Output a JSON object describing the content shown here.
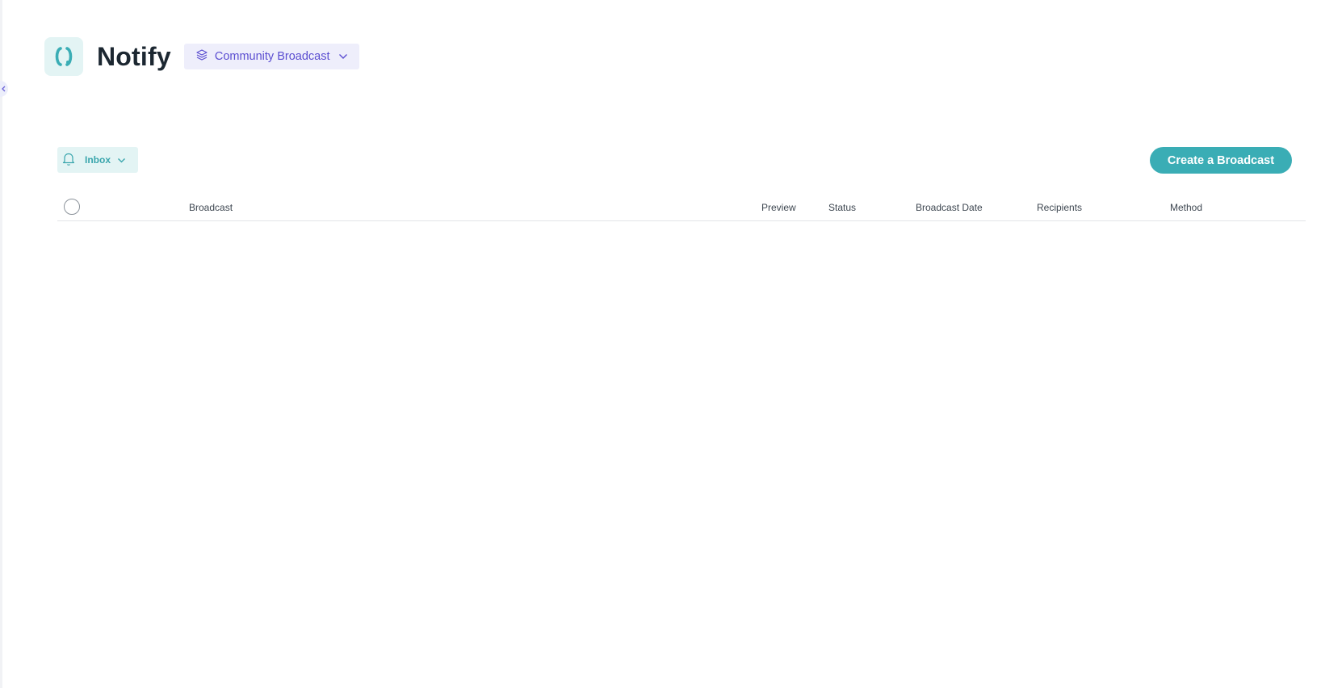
{
  "header": {
    "title": "Notify",
    "logo_icon": "notify-logo-icon",
    "scope_dropdown": {
      "selected": "Community Broadcast",
      "icon": "layers-icon"
    }
  },
  "toolbar": {
    "folder_dropdown": {
      "selected": "Inbox",
      "icon": "bell-icon"
    },
    "create_label": "Create a Broadcast"
  },
  "table": {
    "columns": [
      "Broadcast",
      "Preview",
      "Status",
      "Broadcast Date",
      "Recipients",
      "Method"
    ],
    "rows": []
  },
  "colors": {
    "accent": "#3aadb5",
    "accent_light": "#e3f4f4",
    "scope_text": "#5b4ed1",
    "scope_bg": "#eeeefb"
  }
}
